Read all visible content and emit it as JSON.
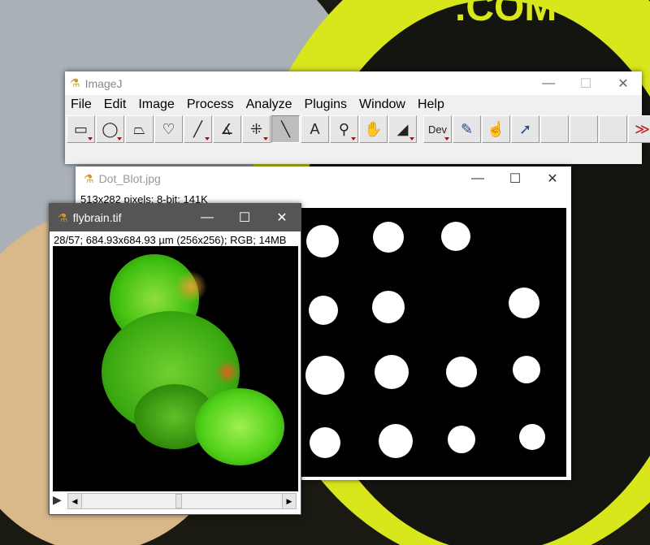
{
  "imagej": {
    "title": "ImageJ",
    "menu": [
      "File",
      "Edit",
      "Image",
      "Process",
      "Analyze",
      "Plugins",
      "Window",
      "Help"
    ],
    "tools": [
      {
        "name": "rectangle-tool",
        "glyph": "▭",
        "dd": true
      },
      {
        "name": "oval-tool",
        "glyph": "◯",
        "dd": true
      },
      {
        "name": "polygon-tool",
        "glyph": "⏢",
        "dd": false
      },
      {
        "name": "freehand-tool",
        "glyph": "♡",
        "dd": false
      },
      {
        "name": "line-tool",
        "glyph": "╱",
        "dd": true
      },
      {
        "name": "angle-tool",
        "glyph": "∡",
        "dd": false
      },
      {
        "name": "multipoint-tool",
        "glyph": "⁜",
        "dd": true
      },
      {
        "name": "wand-tool",
        "glyph": "╲",
        "dd": false,
        "selected": true
      },
      {
        "name": "text-tool",
        "glyph": "A",
        "dd": false
      },
      {
        "name": "magnifier-tool",
        "glyph": "⚲",
        "dd": true
      },
      {
        "name": "hand-tool",
        "glyph": "✋",
        "dd": false
      },
      {
        "name": "color-picker-tool",
        "glyph": "◢",
        "dd": true
      },
      {
        "name": "gap"
      },
      {
        "name": "dev-tool",
        "glyph": "Dev",
        "dd": true
      },
      {
        "name": "brush-tool",
        "glyph": "✎",
        "dd": false
      },
      {
        "name": "flood-fill-tool",
        "glyph": "☝",
        "dd": false
      },
      {
        "name": "arrow-tool",
        "glyph": "➚",
        "dd": false
      },
      {
        "name": "empty-slot",
        "glyph": ""
      },
      {
        "name": "empty-slot",
        "glyph": ""
      },
      {
        "name": "empty-slot",
        "glyph": ""
      },
      {
        "name": "more-tools",
        "glyph": "≫",
        "dd": false
      }
    ]
  },
  "dotblot": {
    "title": "Dot_Blot.jpg",
    "info": "513x282 pixels; 8-bit; 141K"
  },
  "flybrain": {
    "title": "flybrain.tif",
    "info": "28/57; 684.93x684.93 µm (256x256); RGB; 14MB",
    "slice": 28,
    "slices": 57
  },
  "window_controls": {
    "minimize": "—",
    "maximize": "☐",
    "close": "✕"
  }
}
